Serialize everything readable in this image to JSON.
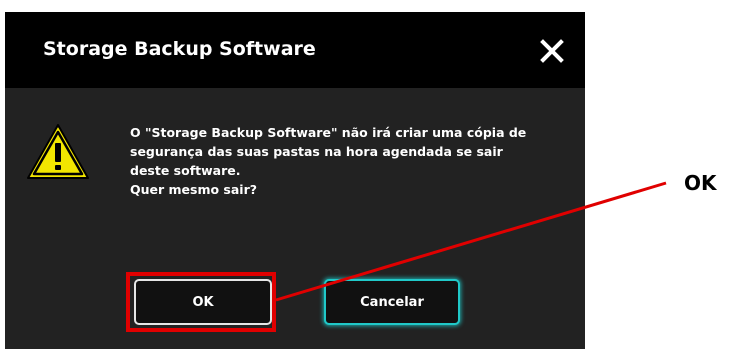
{
  "dialog": {
    "title": "Storage Backup Software",
    "close_icon": "close-icon",
    "warning_icon": "warning-triangle-icon",
    "message_lines": [
      "O \"Storage Backup Software\" não irá criar uma cópia de",
      "segurança das suas pastas na hora agendada se sair",
      "deste software.",
      "Quer mesmo sair?"
    ],
    "ok_label": "OK",
    "cancel_label": "Cancelar"
  },
  "annotation": {
    "callout_label": "OK",
    "highlight_color": "#e00000"
  },
  "colors": {
    "dialog_title_bg": "#000000",
    "dialog_body_bg": "#222222",
    "cancel_focus_border": "#20c9c9",
    "warning_yellow": "#f2e600"
  }
}
